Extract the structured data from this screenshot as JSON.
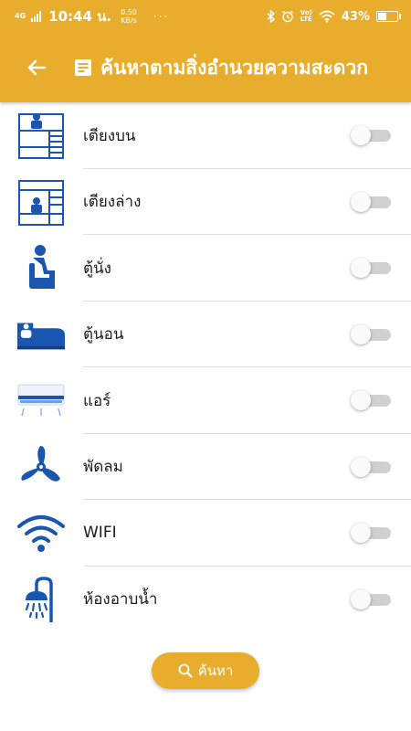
{
  "status_bar": {
    "network": "4G",
    "time": "10:44 น.",
    "speed_value": "0.50",
    "speed_unit": "KB/s",
    "dots": "···",
    "volte_top": "Vo)",
    "volte_bottom": "LTE",
    "battery": "43%"
  },
  "app_bar": {
    "back_icon": "arrow-left-icon",
    "title_icon": "document-icon",
    "title": "ค้นหาตามสิ่งอำนวยความสะดวก"
  },
  "facilities": [
    {
      "label": "เตียงบน",
      "icon": "upper-bunk-icon",
      "enabled": false
    },
    {
      "label": "เตียงล่าง",
      "icon": "lower-bunk-icon",
      "enabled": false
    },
    {
      "label": "ตู้นั่ง",
      "icon": "seat-icon",
      "enabled": false
    },
    {
      "label": "ตู้นอน",
      "icon": "bed-icon",
      "enabled": false
    },
    {
      "label": "แอร์",
      "icon": "air-conditioner-icon",
      "enabled": false
    },
    {
      "label": "พัดลม",
      "icon": "fan-icon",
      "enabled": false
    },
    {
      "label": "WIFI",
      "icon": "wifi-icon",
      "enabled": false
    },
    {
      "label": "ห้องอาบน้ำ",
      "icon": "shower-icon",
      "enabled": false
    }
  ],
  "search_button": {
    "icon": "search-icon",
    "label": "ค้นหา"
  },
  "colors": {
    "accent": "#e8ad2c",
    "icon_blue": "#1a56b0",
    "divider": "#e0e0e0"
  }
}
